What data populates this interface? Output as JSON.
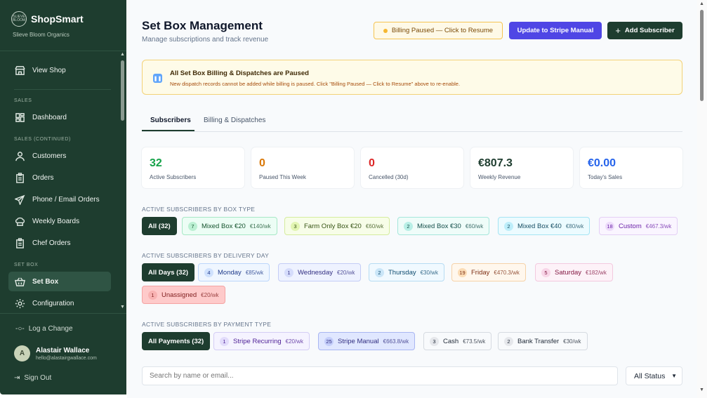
{
  "brand": {
    "name": "ShopSmart",
    "subtitle": "Slieve Bloom Organics",
    "logo_text": "SLIEVE BLOOM"
  },
  "sidebar": {
    "view_shop": "View Shop",
    "sections": {
      "sales": "SALES",
      "sales_continued": "SALES (CONTINUED)",
      "set_box": "SET BOX"
    },
    "items": {
      "dashboard": "Dashboard",
      "customers": "Customers",
      "orders": "Orders",
      "phone_email_orders": "Phone / Email Orders",
      "weekly_boards": "Weekly Boards",
      "chef_orders": "Chef Orders",
      "set_box": "Set Box",
      "configuration": "Configuration"
    },
    "log_change": "Log a Change",
    "user": {
      "initial": "A",
      "name": "Alastair Wallace",
      "email": "hello@alastairgwallace.com"
    },
    "sign_out": "Sign Out"
  },
  "header": {
    "title": "Set Box Management",
    "subtitle": "Manage subscriptions and track revenue",
    "billing_paused_button": "Billing Paused — Click to Resume",
    "stripe_button": "Update to Stripe Manual",
    "add_button": "Add Subscriber"
  },
  "alert": {
    "title": "All Set Box Billing & Dispatches are Paused",
    "text": "New dispatch records cannot be added while billing is paused. Click \"Billing Paused — Click to Resume\" above to re-enable."
  },
  "tabs": [
    "Subscribers",
    "Billing & Dispatches"
  ],
  "stats": [
    {
      "value": "32",
      "label": "Active Subscribers",
      "color": "#16a34a"
    },
    {
      "value": "0",
      "label": "Paused This Week",
      "color": "#d97706"
    },
    {
      "value": "0",
      "label": "Cancelled (30d)",
      "color": "#dc2626"
    },
    {
      "value": "€807.3",
      "label": "Weekly Revenue",
      "color": "#1e3d2f"
    },
    {
      "value": "€0.00",
      "label": "Today's Sales",
      "color": "#2563eb"
    }
  ],
  "box_type": {
    "label": "ACTIVE SUBSCRIBERS BY BOX TYPE",
    "all": "All (32)",
    "chips": [
      {
        "count": "7",
        "name": "Mixed Box €20",
        "rate": "€140/wk"
      },
      {
        "count": "3",
        "name": "Farm Only Box €20",
        "rate": "€60/wk"
      },
      {
        "count": "2",
        "name": "Mixed Box €30",
        "rate": "€60/wk"
      },
      {
        "count": "2",
        "name": "Mixed Box €40",
        "rate": "€80/wk"
      },
      {
        "count": "18",
        "name": "Custom",
        "rate": "€467.3/wk"
      }
    ]
  },
  "delivery_day": {
    "label": "ACTIVE SUBSCRIBERS BY DELIVERY DAY",
    "all": "All Days (32)",
    "chips": [
      {
        "count": "4",
        "name": "Monday",
        "rate": "€85/wk"
      },
      {
        "count": "1",
        "name": "Wednesday",
        "rate": "€20/wk"
      },
      {
        "count": "2",
        "name": "Thursday",
        "rate": "€30/wk"
      },
      {
        "count": "19",
        "name": "Friday",
        "rate": "€470.3/wk"
      },
      {
        "count": "5",
        "name": "Saturday",
        "rate": "€182/wk"
      },
      {
        "count": "1",
        "name": "Unassigned",
        "rate": "€20/wk"
      }
    ]
  },
  "payment_type": {
    "label": "ACTIVE SUBSCRIBERS BY PAYMENT TYPE",
    "all": "All Payments (32)",
    "chips": [
      {
        "count": "1",
        "name": "Stripe Recurring",
        "rate": "€20/wk"
      },
      {
        "count": "25",
        "name": "Stripe Manual",
        "rate": "€663.8/wk"
      },
      {
        "count": "3",
        "name": "Cash",
        "rate": "€73.5/wk"
      },
      {
        "count": "2",
        "name": "Bank Transfer",
        "rate": "€30/wk"
      }
    ]
  },
  "search": {
    "placeholder": "Search by name or email..."
  },
  "status_filter": {
    "value": "All Status"
  },
  "colors": {
    "sidebar": "#1e3d2f",
    "accent": "#4f46e5",
    "paused": "#f5b731"
  }
}
